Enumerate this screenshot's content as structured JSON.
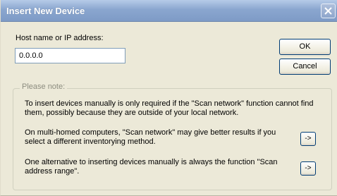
{
  "window": {
    "title": "Insert New Device"
  },
  "host": {
    "label": "Host name or IP address:",
    "value": "0.0.0.0"
  },
  "buttons": {
    "ok": "OK",
    "cancel": "Cancel",
    "scan_arrow_1": "->",
    "scan_arrow_2": "->"
  },
  "note": {
    "legend": "Please note:",
    "paragraph_1": "To insert devices manually is only required if the \"Scan network\" function cannot find them, possibly because they are outside of your local network.",
    "paragraph_2": "On multi-homed computers, \"Scan network\" may give better results if you select a different inventorying method.",
    "paragraph_3": "One alternative to inserting devices manually is always the function \"Scan address range\"."
  },
  "icons": {
    "close": "close-icon"
  }
}
